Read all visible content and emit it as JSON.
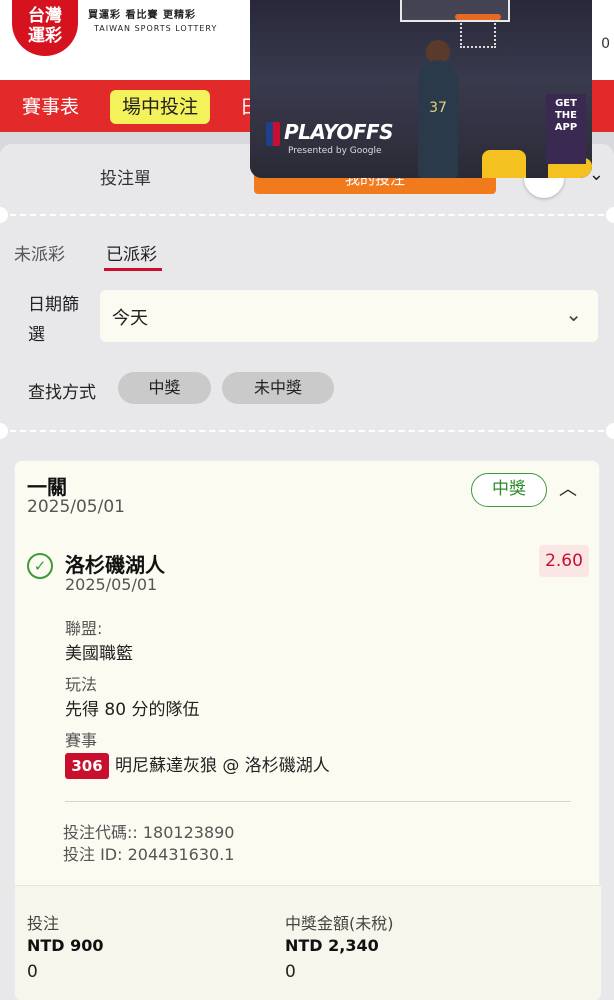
{
  "header": {
    "logo_line1": "台灣",
    "logo_line2": "運彩",
    "slogan": "買運彩 看比賽 更精彩",
    "logo_en": "TAIWAN SPORTS LOTTERY",
    "right_text": "0"
  },
  "nav": {
    "items": [
      {
        "label": "賽事表"
      },
      {
        "label": "場中投注"
      },
      {
        "label": "日"
      }
    ]
  },
  "slip": {
    "title": "投注單",
    "action_button": "我的投注",
    "tabs": [
      {
        "label": "未派彩"
      },
      {
        "label": "已派彩"
      }
    ],
    "date_filter": {
      "label": "日期篩選",
      "value": "今天"
    },
    "search": {
      "label": "查找方式",
      "options": [
        "中獎",
        "未中獎"
      ]
    }
  },
  "bet": {
    "type": "一關",
    "date": "2025/05/01",
    "status": "中獎",
    "selection": {
      "team": "洛杉磯湖人",
      "date": "2025/05/01",
      "odds": "2.60",
      "league_label": "聯盟:",
      "league": "美國職籃",
      "market_label": "玩法",
      "market": "先得 80 分的隊伍",
      "event_label": "賽事",
      "event_number": "306",
      "event": "明尼蘇達灰狼 @ 洛杉磯湖人"
    },
    "code": "投注代碼:: 180123890",
    "bet_id": "投注 ID: 204431630.1",
    "stake_label": "投注",
    "stake_value": "NTD 900",
    "stake_sub": "0",
    "payout_label": "中獎金額(未稅)",
    "payout_value": "NTD 2,340",
    "payout_sub": "0"
  },
  "video": {
    "brand": "PLAYOFFS",
    "sponsor": "Presented by Google",
    "jersey": "37",
    "side_text": "GET THE APP"
  }
}
